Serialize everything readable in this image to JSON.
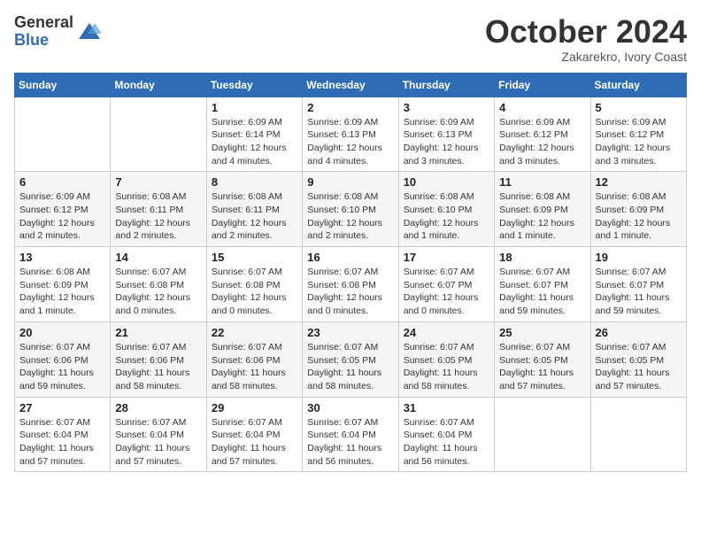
{
  "header": {
    "logo_general": "General",
    "logo_blue": "Blue",
    "month_title": "October 2024",
    "subtitle": "Zakarekro, Ivory Coast"
  },
  "days_of_week": [
    "Sunday",
    "Monday",
    "Tuesday",
    "Wednesday",
    "Thursday",
    "Friday",
    "Saturday"
  ],
  "weeks": [
    [
      {
        "day": "",
        "info": ""
      },
      {
        "day": "",
        "info": ""
      },
      {
        "day": "1",
        "info": "Sunrise: 6:09 AM\nSunset: 6:14 PM\nDaylight: 12 hours and 4 minutes."
      },
      {
        "day": "2",
        "info": "Sunrise: 6:09 AM\nSunset: 6:13 PM\nDaylight: 12 hours and 4 minutes."
      },
      {
        "day": "3",
        "info": "Sunrise: 6:09 AM\nSunset: 6:13 PM\nDaylight: 12 hours and 3 minutes."
      },
      {
        "day": "4",
        "info": "Sunrise: 6:09 AM\nSunset: 6:12 PM\nDaylight: 12 hours and 3 minutes."
      },
      {
        "day": "5",
        "info": "Sunrise: 6:09 AM\nSunset: 6:12 PM\nDaylight: 12 hours and 3 minutes."
      }
    ],
    [
      {
        "day": "6",
        "info": "Sunrise: 6:09 AM\nSunset: 6:12 PM\nDaylight: 12 hours and 2 minutes."
      },
      {
        "day": "7",
        "info": "Sunrise: 6:08 AM\nSunset: 6:11 PM\nDaylight: 12 hours and 2 minutes."
      },
      {
        "day": "8",
        "info": "Sunrise: 6:08 AM\nSunset: 6:11 PM\nDaylight: 12 hours and 2 minutes."
      },
      {
        "day": "9",
        "info": "Sunrise: 6:08 AM\nSunset: 6:10 PM\nDaylight: 12 hours and 2 minutes."
      },
      {
        "day": "10",
        "info": "Sunrise: 6:08 AM\nSunset: 6:10 PM\nDaylight: 12 hours and 1 minute."
      },
      {
        "day": "11",
        "info": "Sunrise: 6:08 AM\nSunset: 6:09 PM\nDaylight: 12 hours and 1 minute."
      },
      {
        "day": "12",
        "info": "Sunrise: 6:08 AM\nSunset: 6:09 PM\nDaylight: 12 hours and 1 minute."
      }
    ],
    [
      {
        "day": "13",
        "info": "Sunrise: 6:08 AM\nSunset: 6:09 PM\nDaylight: 12 hours and 1 minute."
      },
      {
        "day": "14",
        "info": "Sunrise: 6:07 AM\nSunset: 6:08 PM\nDaylight: 12 hours and 0 minutes."
      },
      {
        "day": "15",
        "info": "Sunrise: 6:07 AM\nSunset: 6:08 PM\nDaylight: 12 hours and 0 minutes."
      },
      {
        "day": "16",
        "info": "Sunrise: 6:07 AM\nSunset: 6:08 PM\nDaylight: 12 hours and 0 minutes."
      },
      {
        "day": "17",
        "info": "Sunrise: 6:07 AM\nSunset: 6:07 PM\nDaylight: 12 hours and 0 minutes."
      },
      {
        "day": "18",
        "info": "Sunrise: 6:07 AM\nSunset: 6:07 PM\nDaylight: 11 hours and 59 minutes."
      },
      {
        "day": "19",
        "info": "Sunrise: 6:07 AM\nSunset: 6:07 PM\nDaylight: 11 hours and 59 minutes."
      }
    ],
    [
      {
        "day": "20",
        "info": "Sunrise: 6:07 AM\nSunset: 6:06 PM\nDaylight: 11 hours and 59 minutes."
      },
      {
        "day": "21",
        "info": "Sunrise: 6:07 AM\nSunset: 6:06 PM\nDaylight: 11 hours and 58 minutes."
      },
      {
        "day": "22",
        "info": "Sunrise: 6:07 AM\nSunset: 6:06 PM\nDaylight: 11 hours and 58 minutes."
      },
      {
        "day": "23",
        "info": "Sunrise: 6:07 AM\nSunset: 6:05 PM\nDaylight: 11 hours and 58 minutes."
      },
      {
        "day": "24",
        "info": "Sunrise: 6:07 AM\nSunset: 6:05 PM\nDaylight: 11 hours and 58 minutes."
      },
      {
        "day": "25",
        "info": "Sunrise: 6:07 AM\nSunset: 6:05 PM\nDaylight: 11 hours and 57 minutes."
      },
      {
        "day": "26",
        "info": "Sunrise: 6:07 AM\nSunset: 6:05 PM\nDaylight: 11 hours and 57 minutes."
      }
    ],
    [
      {
        "day": "27",
        "info": "Sunrise: 6:07 AM\nSunset: 6:04 PM\nDaylight: 11 hours and 57 minutes."
      },
      {
        "day": "28",
        "info": "Sunrise: 6:07 AM\nSunset: 6:04 PM\nDaylight: 11 hours and 57 minutes."
      },
      {
        "day": "29",
        "info": "Sunrise: 6:07 AM\nSunset: 6:04 PM\nDaylight: 11 hours and 57 minutes."
      },
      {
        "day": "30",
        "info": "Sunrise: 6:07 AM\nSunset: 6:04 PM\nDaylight: 11 hours and 56 minutes."
      },
      {
        "day": "31",
        "info": "Sunrise: 6:07 AM\nSunset: 6:04 PM\nDaylight: 11 hours and 56 minutes."
      },
      {
        "day": "",
        "info": ""
      },
      {
        "day": "",
        "info": ""
      }
    ]
  ]
}
